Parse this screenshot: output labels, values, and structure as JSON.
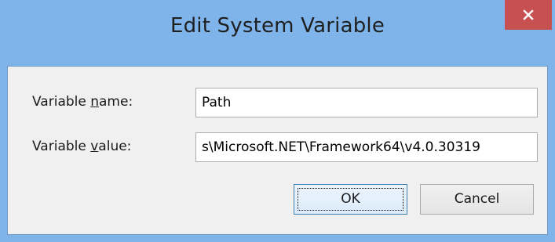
{
  "window": {
    "title": "Edit System Variable",
    "close_icon": "close-icon",
    "accent_color": "#7eb4ea",
    "close_color": "#c75050"
  },
  "form": {
    "name_label_prefix": "Variable ",
    "name_label_mnemonic": "n",
    "name_label_suffix": "ame:",
    "name_value": "Path",
    "value_label_prefix": "Variable ",
    "value_label_mnemonic": "v",
    "value_label_suffix": "alue:",
    "value_value": "s\\Microsoft.NET\\Framework64\\v4.0.30319"
  },
  "buttons": {
    "ok_label": "OK",
    "cancel_label": "Cancel"
  }
}
